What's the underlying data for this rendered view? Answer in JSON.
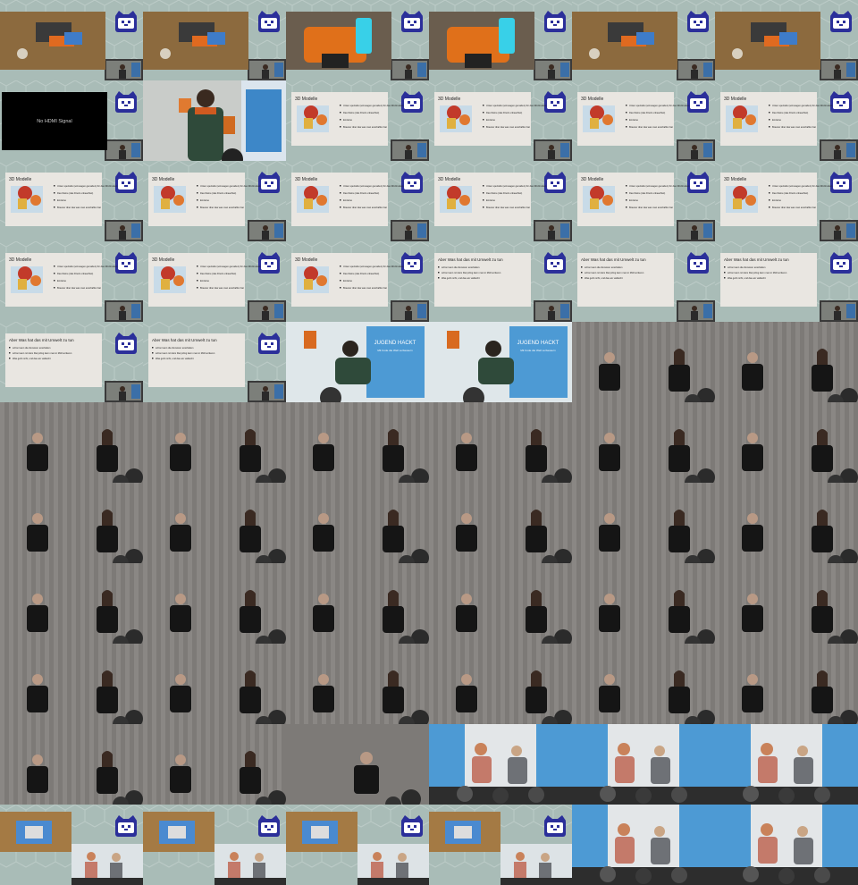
{
  "no_signal_text": "No HDMI Signal",
  "slide_3d_title": "3D Modelle",
  "slide_3d_bullets": [
    "Unten spezielle (sozusagen gemalten) für das 3D-Drucken",
    "Das Kleine (das Druck unbeachtet)",
    "Einzelne",
    "Brauner über das was man anschaffen hat"
  ],
  "slide_env_title": "Aber Was hat das mit Umwelt zu tun",
  "slide_env_bullets": [
    "schon kann die Zensoren anschalten",
    "schon kann mit dem Recycling kann man in Müll sortieren",
    "Was geht nicht, und das am vielleicht"
  ],
  "banner_text_1": "JUGEND HACKT",
  "banner_text_2": "Mit Code die Welt verbessern",
  "rows": [
    [
      "desk",
      "desk",
      "printer",
      "printer",
      "desk",
      "desk"
    ],
    [
      "nosignal",
      "speaker",
      "slide3d",
      "slide3d",
      "slide3d",
      "slide3d"
    ],
    [
      "slide3d",
      "slide3d",
      "slide3d",
      "slide3d",
      "slide3d",
      "slide3d"
    ],
    [
      "slide3d",
      "slide3d",
      "slide3d",
      "slideenv",
      "slideenv",
      "slideenv"
    ],
    [
      "slideenv",
      "slideenv",
      "kneel",
      "kneel",
      "duo",
      "duo"
    ],
    [
      "duo",
      "duo",
      "duo",
      "duo",
      "duo",
      "duo"
    ],
    [
      "duo",
      "duo",
      "duo",
      "duo",
      "duo",
      "duo"
    ],
    [
      "duo",
      "duo",
      "duo",
      "duo",
      "duo",
      "duo"
    ],
    [
      "duo",
      "duo",
      "duo",
      "duo",
      "duo",
      "duo"
    ],
    [
      "duo",
      "duo",
      "solo",
      "girls",
      "girls",
      "girls"
    ],
    [
      "tablet",
      "tablet",
      "tablet",
      "tablet",
      "girls",
      "girls"
    ]
  ]
}
